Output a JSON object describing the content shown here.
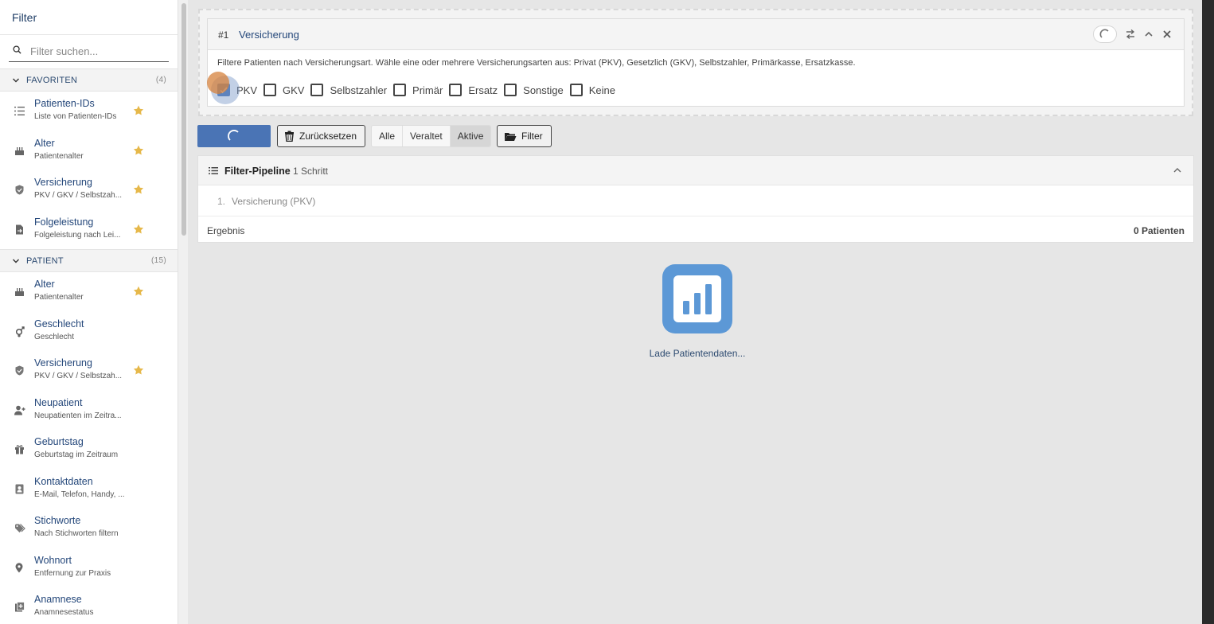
{
  "sidebar": {
    "title": "Filter",
    "search_placeholder": "Filter suchen...",
    "groups": [
      {
        "name": "FAVORITEN",
        "count": "(4)",
        "items": [
          {
            "title": "Patienten-IDs",
            "subtitle": "Liste von Patienten-IDs",
            "icon": "list-numbers-icon",
            "starred": true
          },
          {
            "title": "Alter",
            "subtitle": "Patientenalter",
            "icon": "cake-icon",
            "starred": true
          },
          {
            "title": "Versicherung",
            "subtitle": "PKV / GKV / Selbstzah...",
            "icon": "shield-icon",
            "starred": true
          },
          {
            "title": "Folgeleistung",
            "subtitle": "Folgeleistung nach Lei...",
            "icon": "document-arrow-icon",
            "starred": true
          }
        ]
      },
      {
        "name": "PATIENT",
        "count": "(15)",
        "items": [
          {
            "title": "Alter",
            "subtitle": "Patientenalter",
            "icon": "cake-icon",
            "starred": true
          },
          {
            "title": "Geschlecht",
            "subtitle": "Geschlecht",
            "icon": "gender-icon",
            "starred": false
          },
          {
            "title": "Versicherung",
            "subtitle": "PKV / GKV / Selbstzah...",
            "icon": "shield-icon",
            "starred": true
          },
          {
            "title": "Neupatient",
            "subtitle": "Neupatienten im Zeitra...",
            "icon": "person-add-icon",
            "starred": false
          },
          {
            "title": "Geburtstag",
            "subtitle": "Geburtstag im Zeitraum",
            "icon": "gift-icon",
            "starred": false
          },
          {
            "title": "Kontaktdaten",
            "subtitle": "E-Mail, Telefon, Handy, ...",
            "icon": "contact-card-icon",
            "starred": false
          },
          {
            "title": "Stichworte",
            "subtitle": "Nach Stichworten filtern",
            "icon": "tag-icon",
            "starred": false
          },
          {
            "title": "Wohnort",
            "subtitle": "Entfernung zur Praxis",
            "icon": "location-pin-icon",
            "starred": false
          },
          {
            "title": "Anamnese",
            "subtitle": "Anamnesestatus",
            "icon": "clipboard-icon",
            "starred": false
          }
        ]
      }
    ]
  },
  "step": {
    "number": "#1",
    "title": "Versicherung",
    "description": "Filtere Patienten nach Versicherungsart. Wähle eine oder mehrere Versicherungsarten aus: Privat (PKV), Gesetzlich (GKV), Selbstzahler, Primärkasse, Ersatzkasse.",
    "options": [
      {
        "label": "PKV",
        "checked": true
      },
      {
        "label": "GKV",
        "checked": false
      },
      {
        "label": "Selbstzahler",
        "checked": false
      },
      {
        "label": "Primär",
        "checked": false
      },
      {
        "label": "Ersatz",
        "checked": false
      },
      {
        "label": "Sonstige",
        "checked": false
      },
      {
        "label": "Keine",
        "checked": false
      }
    ]
  },
  "toolbar": {
    "reset_label": "Zurücksetzen",
    "segments": [
      "Alle",
      "Veraltet",
      "Aktive"
    ],
    "active_segment": "Aktive",
    "filter_label": "Filter"
  },
  "pipeline": {
    "title": "Filter-Pipeline",
    "step_count": "1 Schritt",
    "steps": [
      {
        "index": "1.",
        "label": "Versicherung (PKV)"
      }
    ],
    "result_label": "Ergebnis",
    "result_value": "0 Patienten"
  },
  "loader": {
    "text": "Lade Patientendaten...",
    "icon": "bar-chart-icon"
  },
  "colors": {
    "primary": "#4a74b5",
    "link": "#24477a",
    "star": "#e6b84a",
    "loader": "#5c98d6"
  }
}
